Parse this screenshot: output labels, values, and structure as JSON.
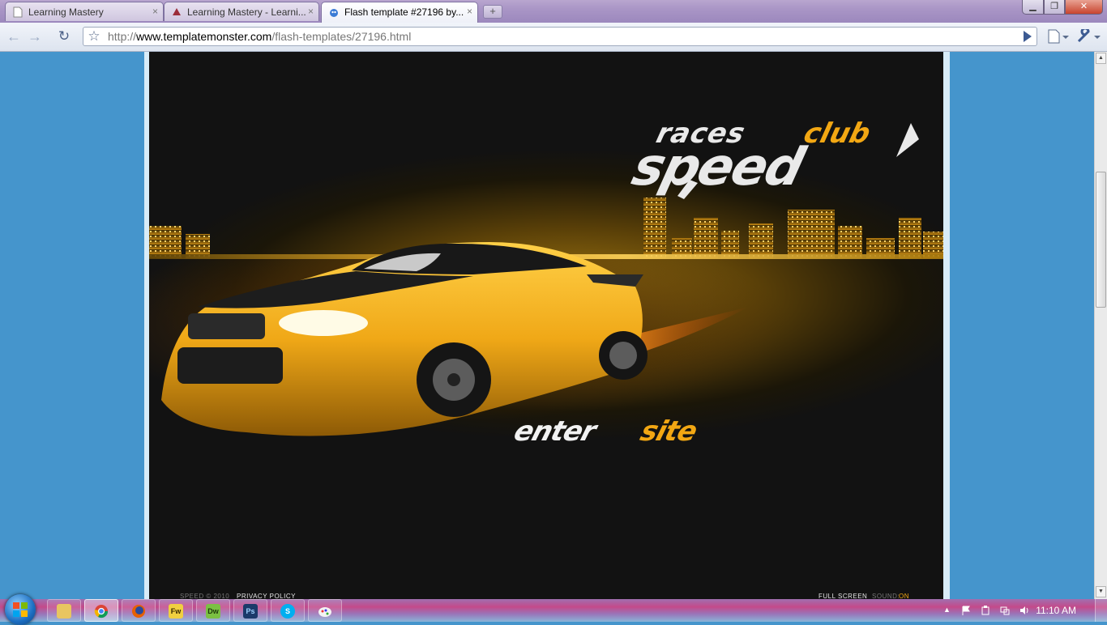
{
  "browser": {
    "tabs": [
      {
        "title": "Learning Mastery",
        "icon": "page-icon",
        "active": false
      },
      {
        "title": "Learning Mastery - Learni...",
        "icon": "site-favicon",
        "active": false
      },
      {
        "title": "Flash template #27196 by...",
        "icon": "templatemonster-favicon",
        "active": true
      }
    ],
    "close_glyph": "×",
    "new_tab_glyph": "+",
    "window_buttons": {
      "minimize": "▁",
      "maximize": "❐",
      "close": "✕"
    },
    "address": {
      "prefix": "http://",
      "domain": "www.templatemonster.com",
      "path": "/flash-templates/27196.html"
    },
    "nav": {
      "back": "←",
      "forward": "→",
      "reload": "↻",
      "star": "☆"
    }
  },
  "flash_page": {
    "logo_top_white": "races",
    "logo_top_accent": "club",
    "logo_main": "speed",
    "enter_word": "enter",
    "site_word": "site",
    "footer": {
      "copyright": "SPEED © 2010",
      "privacy": "PRIVACY POLICY",
      "fullscreen": "FULL SCREEN",
      "sound_label": "SOUND:",
      "sound_value": "ON"
    },
    "colors": {
      "accent": "#f2a713",
      "logo_white": "#e9e9e9"
    }
  },
  "taskbar": {
    "clock": "11:10 AM",
    "pinned": [
      {
        "name": "explorer",
        "label": ""
      },
      {
        "name": "chrome",
        "label": ""
      },
      {
        "name": "firefox",
        "label": ""
      },
      {
        "name": "fireworks",
        "label": "Fw"
      },
      {
        "name": "dreamweaver",
        "label": "Dw"
      },
      {
        "name": "photoshop",
        "label": "Ps"
      },
      {
        "name": "skype",
        "label": "S"
      },
      {
        "name": "paint",
        "label": ""
      }
    ]
  }
}
